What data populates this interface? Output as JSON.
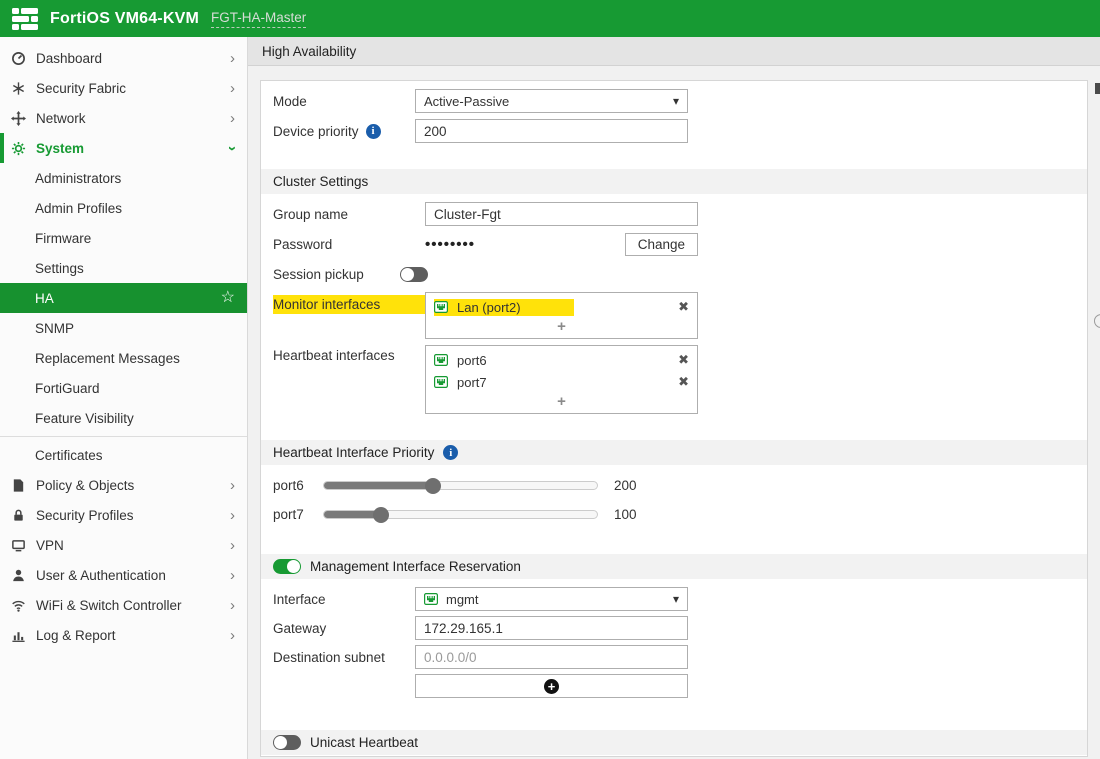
{
  "topbar": {
    "product": "FortiOS VM64-KVM",
    "hostname": "FGT-HA-Master"
  },
  "page": {
    "title": "High Availability"
  },
  "sidebar": {
    "items": [
      {
        "label": "Dashboard",
        "icon": "gauge-icon"
      },
      {
        "label": "Security Fabric",
        "icon": "fabric-icon"
      },
      {
        "label": "Network",
        "icon": "move-arrows-icon"
      },
      {
        "label": "System",
        "icon": "gear-icon",
        "expanded": true,
        "children": [
          "Administrators",
          "Admin Profiles",
          "Firmware",
          "Settings",
          "HA",
          "SNMP",
          "Replacement Messages",
          "FortiGuard",
          "Feature Visibility",
          "Certificates"
        ]
      },
      {
        "label": "Policy & Objects",
        "icon": "policy-icon"
      },
      {
        "label": "Security Profiles",
        "icon": "lock-icon"
      },
      {
        "label": "VPN",
        "icon": "monitor-icon"
      },
      {
        "label": "User & Authentication",
        "icon": "user-icon"
      },
      {
        "label": "WiFi & Switch Controller",
        "icon": "wifi-icon"
      },
      {
        "label": "Log & Report",
        "icon": "bar-chart-icon"
      }
    ],
    "selected": "HA"
  },
  "ha": {
    "mode_label": "Mode",
    "mode_value": "Active-Passive",
    "device_priority_label": "Device priority",
    "device_priority_value": "200",
    "cluster_settings_title": "Cluster Settings",
    "group_name_label": "Group name",
    "group_name_value": "Cluster-Fgt",
    "password_label": "Password",
    "password_mask": "••••••••",
    "change_button": "Change",
    "session_pickup_label": "Session pickup",
    "session_pickup_enabled": false,
    "monitor_interfaces_label": "Monitor interfaces",
    "monitor_interfaces": [
      {
        "name": "Lan (port2)",
        "icon": "ethernet-port-icon"
      }
    ],
    "heartbeat_interfaces_label": "Heartbeat interfaces",
    "heartbeat_interfaces": [
      {
        "name": "port6",
        "icon": "ethernet-port-icon"
      },
      {
        "name": "port7",
        "icon": "ethernet-port-icon"
      }
    ],
    "hb_priority_title": "Heartbeat Interface Priority",
    "hb_priorities": [
      {
        "port": "port6",
        "value": "200",
        "percent": 40
      },
      {
        "port": "port7",
        "value": "100",
        "percent": 21
      }
    ],
    "mgmt_title": "Management Interface Reservation",
    "mgmt_enabled": true,
    "interface_label": "Interface",
    "interface_value": "mgmt",
    "gateway_label": "Gateway",
    "gateway_value": "172.29.165.1",
    "dest_subnet_label": "Destination subnet",
    "dest_subnet_placeholder": "0.0.0.0/0",
    "unicast_title": "Unicast Heartbeat",
    "unicast_enabled": false
  },
  "colors": {
    "accent_green": "#179a33",
    "selected_row_green": "#17912f",
    "highlight_yellow": "#ffe20a",
    "info_blue": "#1a5dab"
  }
}
